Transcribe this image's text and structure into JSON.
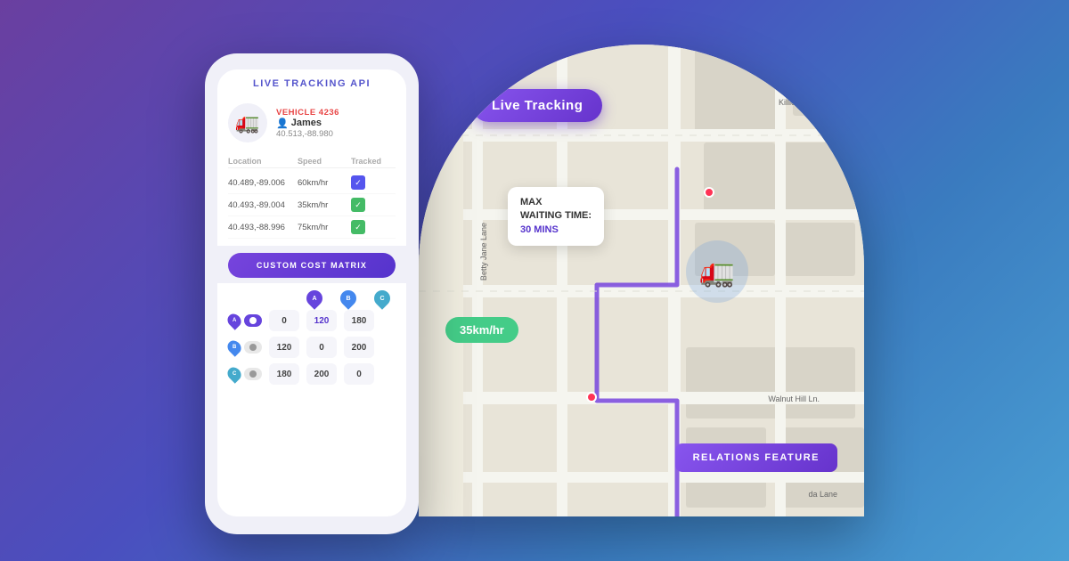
{
  "phone": {
    "header_title": "LIVE TRACKING API",
    "vehicle": {
      "id": "VEHICLE 4236",
      "driver": "James",
      "coords": "40.513,-88.980",
      "icon": "🚛"
    },
    "table": {
      "headers": [
        "Location",
        "Speed",
        "Tracked"
      ],
      "rows": [
        {
          "location": "40.489,-89.006",
          "speed": "60km/hr",
          "checked": "blue"
        },
        {
          "location": "40.493,-89.004",
          "speed": "35km/hr",
          "checked": "green"
        },
        {
          "location": "40.493,-88.996",
          "speed": "75km/hr",
          "checked": "green"
        }
      ]
    },
    "custom_cost_button": "CUSTOM COST MATRIX",
    "matrix": {
      "pins": [
        "A",
        "B",
        "C"
      ],
      "rows": [
        {
          "label": "A",
          "cells": [
            "0",
            "120",
            "180"
          ]
        },
        {
          "label": "B",
          "cells": [
            "120",
            "0",
            "200"
          ]
        },
        {
          "label": "C",
          "cells": [
            "180",
            "200",
            "0"
          ]
        }
      ],
      "highlight": {
        "row": 0,
        "col": 1
      }
    }
  },
  "map": {
    "live_tracking_label": "Live Tracking",
    "speed_label": "35km/hr",
    "relations_label": "RELATIONS FEATURE",
    "waiting_time": {
      "label1": "MAX",
      "label2": "WAITING TIME:",
      "value": "30 MINS"
    },
    "streets": [
      "Betty Jane Lane",
      "Killion Dr",
      "Walnut Hill Ln.",
      "da Lane"
    ]
  }
}
